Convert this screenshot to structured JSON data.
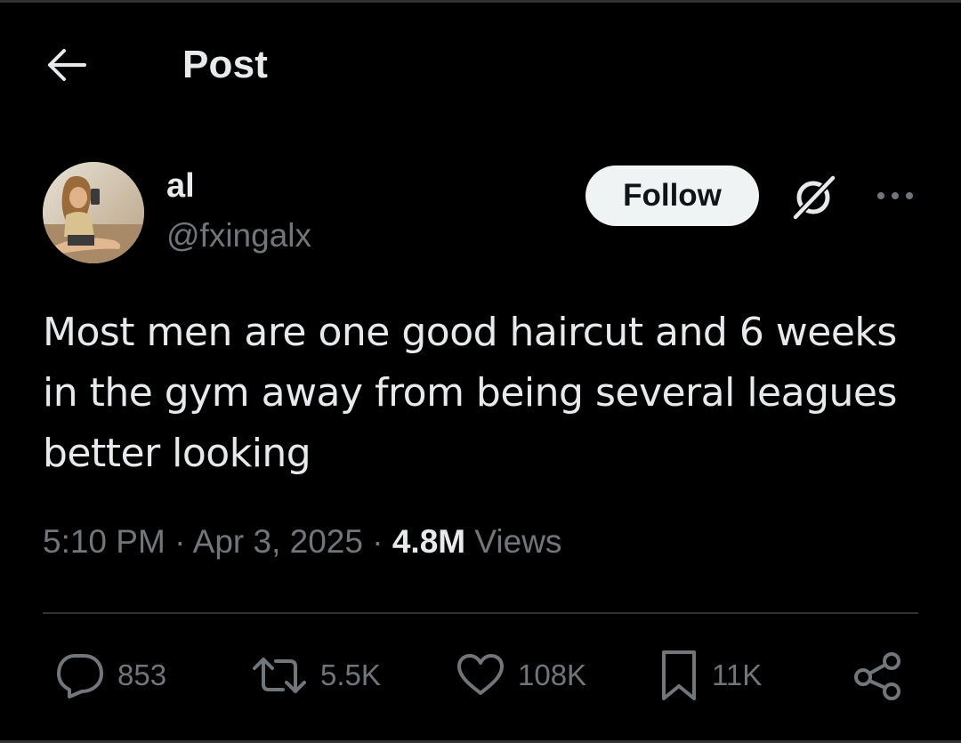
{
  "header": {
    "title": "Post",
    "back_icon": "arrow-left-icon"
  },
  "author": {
    "display_name": "al",
    "handle": "@fxingalx",
    "avatar_description": "avatar-photo"
  },
  "actions_top": {
    "follow_label": "Follow",
    "grok_icon": "grok-icon",
    "more_icon": "more-horizontal-icon"
  },
  "post": {
    "text": "Most men are one good haircut and 6 weeks in the gym away from being several leagues better looking",
    "time": "5:10 PM",
    "date": "Apr 3, 2025",
    "views_count": "4.8M",
    "views_label": "Views"
  },
  "engagement": {
    "replies": "853",
    "reposts": "5.5K",
    "likes": "108K",
    "bookmarks": "11K"
  },
  "colors": {
    "background": "#000000",
    "text_primary": "#e7e9ea",
    "text_secondary": "#71767b",
    "divider": "#2f3336",
    "follow_bg": "#eff3f4"
  }
}
